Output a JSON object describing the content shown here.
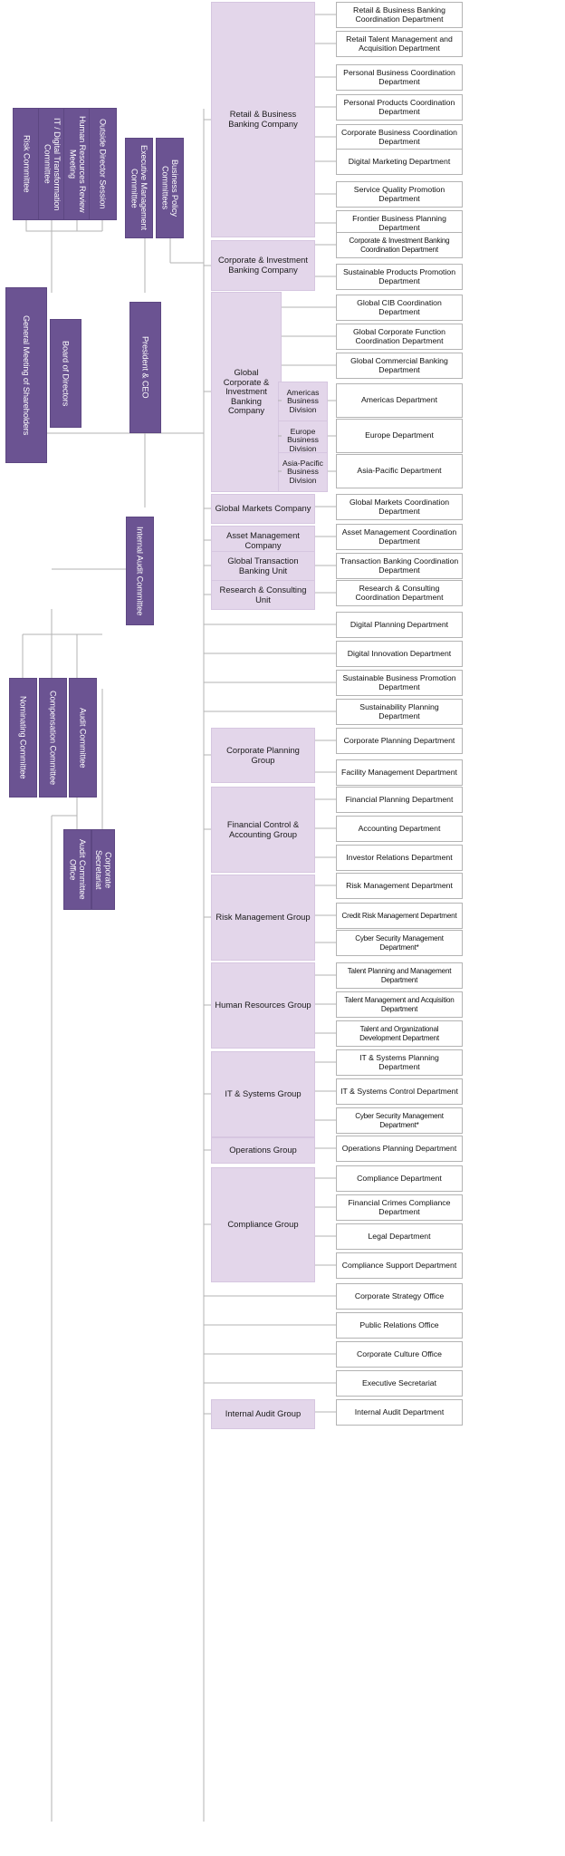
{
  "meta": {
    "title": "Organization Chart",
    "colors": {
      "committee_purple": "#6b5392",
      "group_lavender": "#e3d6ea",
      "department_white": "#ffffff",
      "line_gray": "#b3b3b3"
    }
  },
  "governance": {
    "committees_top": [
      {
        "label": "Risk Committee"
      },
      {
        "label": "IT / Digital Transformation Committee"
      },
      {
        "label": "Human Resources Review Meeting"
      },
      {
        "label": "Outside Director Session"
      }
    ],
    "executive": [
      {
        "label": "Executive Management Committee"
      },
      {
        "label": "Business Policy Committees"
      }
    ],
    "shareholders": {
      "label": "General Meeting of Shareholders"
    },
    "board": {
      "label": "Board of Directors"
    },
    "president": {
      "label": "President & CEO"
    },
    "board_committees": [
      {
        "label": "Nominating Committee"
      },
      {
        "label": "Compensation Committee"
      },
      {
        "label": "Audit Committee"
      }
    ],
    "internal_audit_committee": {
      "label": "Internal Audit Committee"
    },
    "audit_support": [
      {
        "label": "Audit Committee Office"
      },
      {
        "label": "Corporate Secretariat"
      }
    ]
  },
  "business": {
    "companies": [
      {
        "label": "Retail & Business Banking Company",
        "departments": [
          "Retail & Business Banking Coordination Department",
          "Retail Talent Management and Acquisition Department",
          "Personal Business Coordination Department",
          "Personal Products Coordination Department",
          "Corporate Business Coordination Department",
          "Digital Marketing Department",
          "Service Quality Promotion Department",
          "Frontier Business Planning Department"
        ]
      },
      {
        "label": "Corporate & Investment Banking Company",
        "departments": [
          "Corporate & Investment Banking Coordination Department",
          "Sustainable Products Promotion Department"
        ]
      },
      {
        "label": "Global Corporate & Investment Banking Company",
        "departments": [
          "Global CIB Coordination Department",
          "Global Corporate Function Coordination Department",
          "Global Commercial Banking Department"
        ],
        "divisions": [
          {
            "label": "Americas Business Division",
            "department": "Americas Department"
          },
          {
            "label": "Europe Business Division",
            "department": "Europe Department"
          },
          {
            "label": "Asia-Pacific Business Division",
            "department": "Asia-Pacific Department"
          }
        ]
      },
      {
        "label": "Global Markets Company",
        "departments": [
          "Global Markets Coordination Department"
        ]
      },
      {
        "label": "Asset Management Company",
        "departments": [
          "Asset Management Coordination Department"
        ]
      },
      {
        "label": "Global Transaction Banking Unit",
        "departments": [
          "Transaction Banking Coordination Department"
        ]
      },
      {
        "label": "Research & Consulting Unit",
        "departments": [
          "Research & Consulting Coordination Department"
        ]
      }
    ],
    "standalone_departments_upper": [
      "Digital Planning Department",
      "Digital Innovation Department",
      "Sustainable Business Promotion Department",
      "Sustainability Planning Department"
    ],
    "groups": [
      {
        "label": "Corporate Planning Group",
        "departments": [
          "Corporate Planning Department",
          "Facility Management Department"
        ]
      },
      {
        "label": "Financial Control & Accounting Group",
        "departments": [
          "Financial Planning Department",
          "Accounting Department",
          "Investor Relations Department"
        ]
      },
      {
        "label": "Risk Management Group",
        "departments": [
          "Risk Management Department",
          "Credit Risk Management Department",
          "Cyber Security Management Department*"
        ]
      },
      {
        "label": "Human Resources Group",
        "departments": [
          "Talent Planning and Management Department",
          "Talent Management and Acquisition Department",
          "Talent and Organizational Development Department"
        ]
      },
      {
        "label": "IT & Systems Group",
        "departments": [
          "IT & Systems Planning Department",
          "IT & Systems Control Department",
          "Cyber Security Management Department*"
        ]
      },
      {
        "label": "Operations Group",
        "departments": [
          "Operations Planning Department"
        ]
      },
      {
        "label": "Compliance Group",
        "departments": [
          "Compliance Department",
          "Financial Crimes Compliance Department",
          "Legal Department",
          "Compliance Support Department"
        ]
      }
    ],
    "standalone_departments_lower": [
      "Corporate Strategy Office",
      "Public Relations Office",
      "Corporate Culture Office",
      "Executive Secretariat"
    ],
    "internal_audit_group": {
      "label": "Internal Audit Group",
      "departments": [
        "Internal Audit Department"
      ]
    }
  }
}
